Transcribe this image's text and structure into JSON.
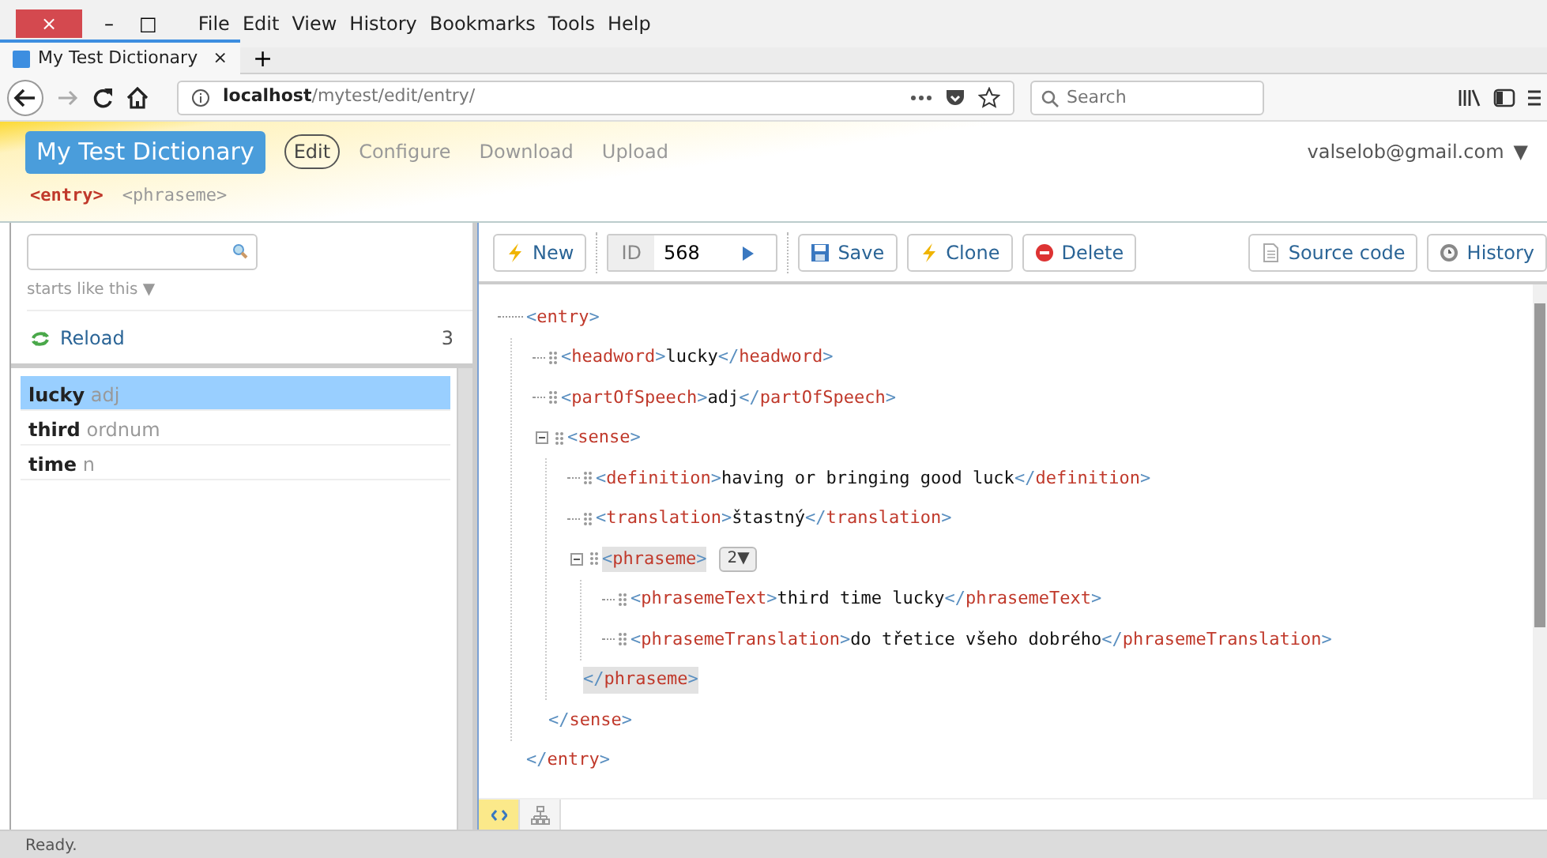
{
  "browser": {
    "window_controls": [
      {
        "kind": "close",
        "label": "×"
      },
      {
        "kind": "minimize",
        "label": "–"
      },
      {
        "kind": "maximize",
        "label": "□"
      }
    ],
    "menu": [
      "File",
      "Edit",
      "View",
      "History",
      "Bookmarks",
      "Tools",
      "Help"
    ],
    "tabs": [
      {
        "title": "My Test Dictionary",
        "close": "×",
        "selected": true
      }
    ],
    "new_tab": "+",
    "url": "**localhost**/mytest/edit/entry/",
    "search": {
      "placeholder": "Search"
    }
  },
  "app": {
    "brand": "My Test Dictionary",
    "nav": [
      {
        "label": "Edit",
        "selected": true
      },
      {
        "label": "Configure",
        "selected": false
      },
      {
        "label": "Download",
        "selected": false
      },
      {
        "label": "Upload",
        "selected": false
      }
    ],
    "user": "valselob@gmail.com",
    "user_caret": "▼",
    "doctypes": [
      {
        "label": "<entry>",
        "selected": true
      },
      {
        "label": "<phraseme>",
        "selected": false
      }
    ]
  },
  "sidebar": {
    "filter": "starts like this",
    "filter_caret": "▼",
    "reload": "Reload",
    "count": "3",
    "entries": [
      {
        "headword": "lucky",
        "pos": "adj",
        "selected": true
      },
      {
        "headword": "third",
        "pos": "ordnum",
        "selected": false
      },
      {
        "headword": "time",
        "pos": "n",
        "selected": false
      }
    ]
  },
  "toolbar": {
    "left": [
      {
        "kind": "new",
        "label": "New"
      }
    ],
    "id": {
      "label": "ID",
      "value": "568"
    },
    "actions": [
      {
        "kind": "save",
        "label": "Save"
      },
      {
        "kind": "clone",
        "label": "Clone"
      },
      {
        "kind": "delete",
        "label": "Delete"
      }
    ],
    "right": [
      {
        "kind": "source",
        "label": "Source code"
      },
      {
        "kind": "history",
        "label": "History"
      }
    ]
  },
  "editor": {
    "tree": {
      "open": "<entry>",
      "close": "</entry>",
      "children": [
        {
          "open": "<headword>",
          "value": "lucky",
          "close": "</headword>"
        },
        {
          "open": "<partOfSpeech>",
          "value": "adj",
          "close": "</partOfSpeech>"
        },
        {
          "open": "<sense>",
          "close": "</sense>",
          "expanded": true,
          "children": [
            {
              "open": "<definition>",
              "value": "having or bringing good luck",
              "close": "</definition>"
            },
            {
              "open": "<translation>",
              "value": "štastný",
              "close": "</translation>"
            },
            {
              "open": "<phraseme>",
              "close": "</phraseme>",
              "expanded": true,
              "selected": true,
              "badge": "2▼",
              "children": [
                {
                  "open": "<phrasemeText>",
                  "value": "third time lucky",
                  "close": "</phrasemeText>"
                },
                {
                  "open": "<phrasemeTranslation>",
                  "value": "do třetice všeho dobrého",
                  "close": "</phrasemeTranslation>"
                }
              ]
            }
          ]
        }
      ]
    },
    "modes": [
      {
        "kind": "code",
        "selected": true
      },
      {
        "kind": "tree",
        "selected": false
      }
    ]
  },
  "status_bar": "Ready."
}
